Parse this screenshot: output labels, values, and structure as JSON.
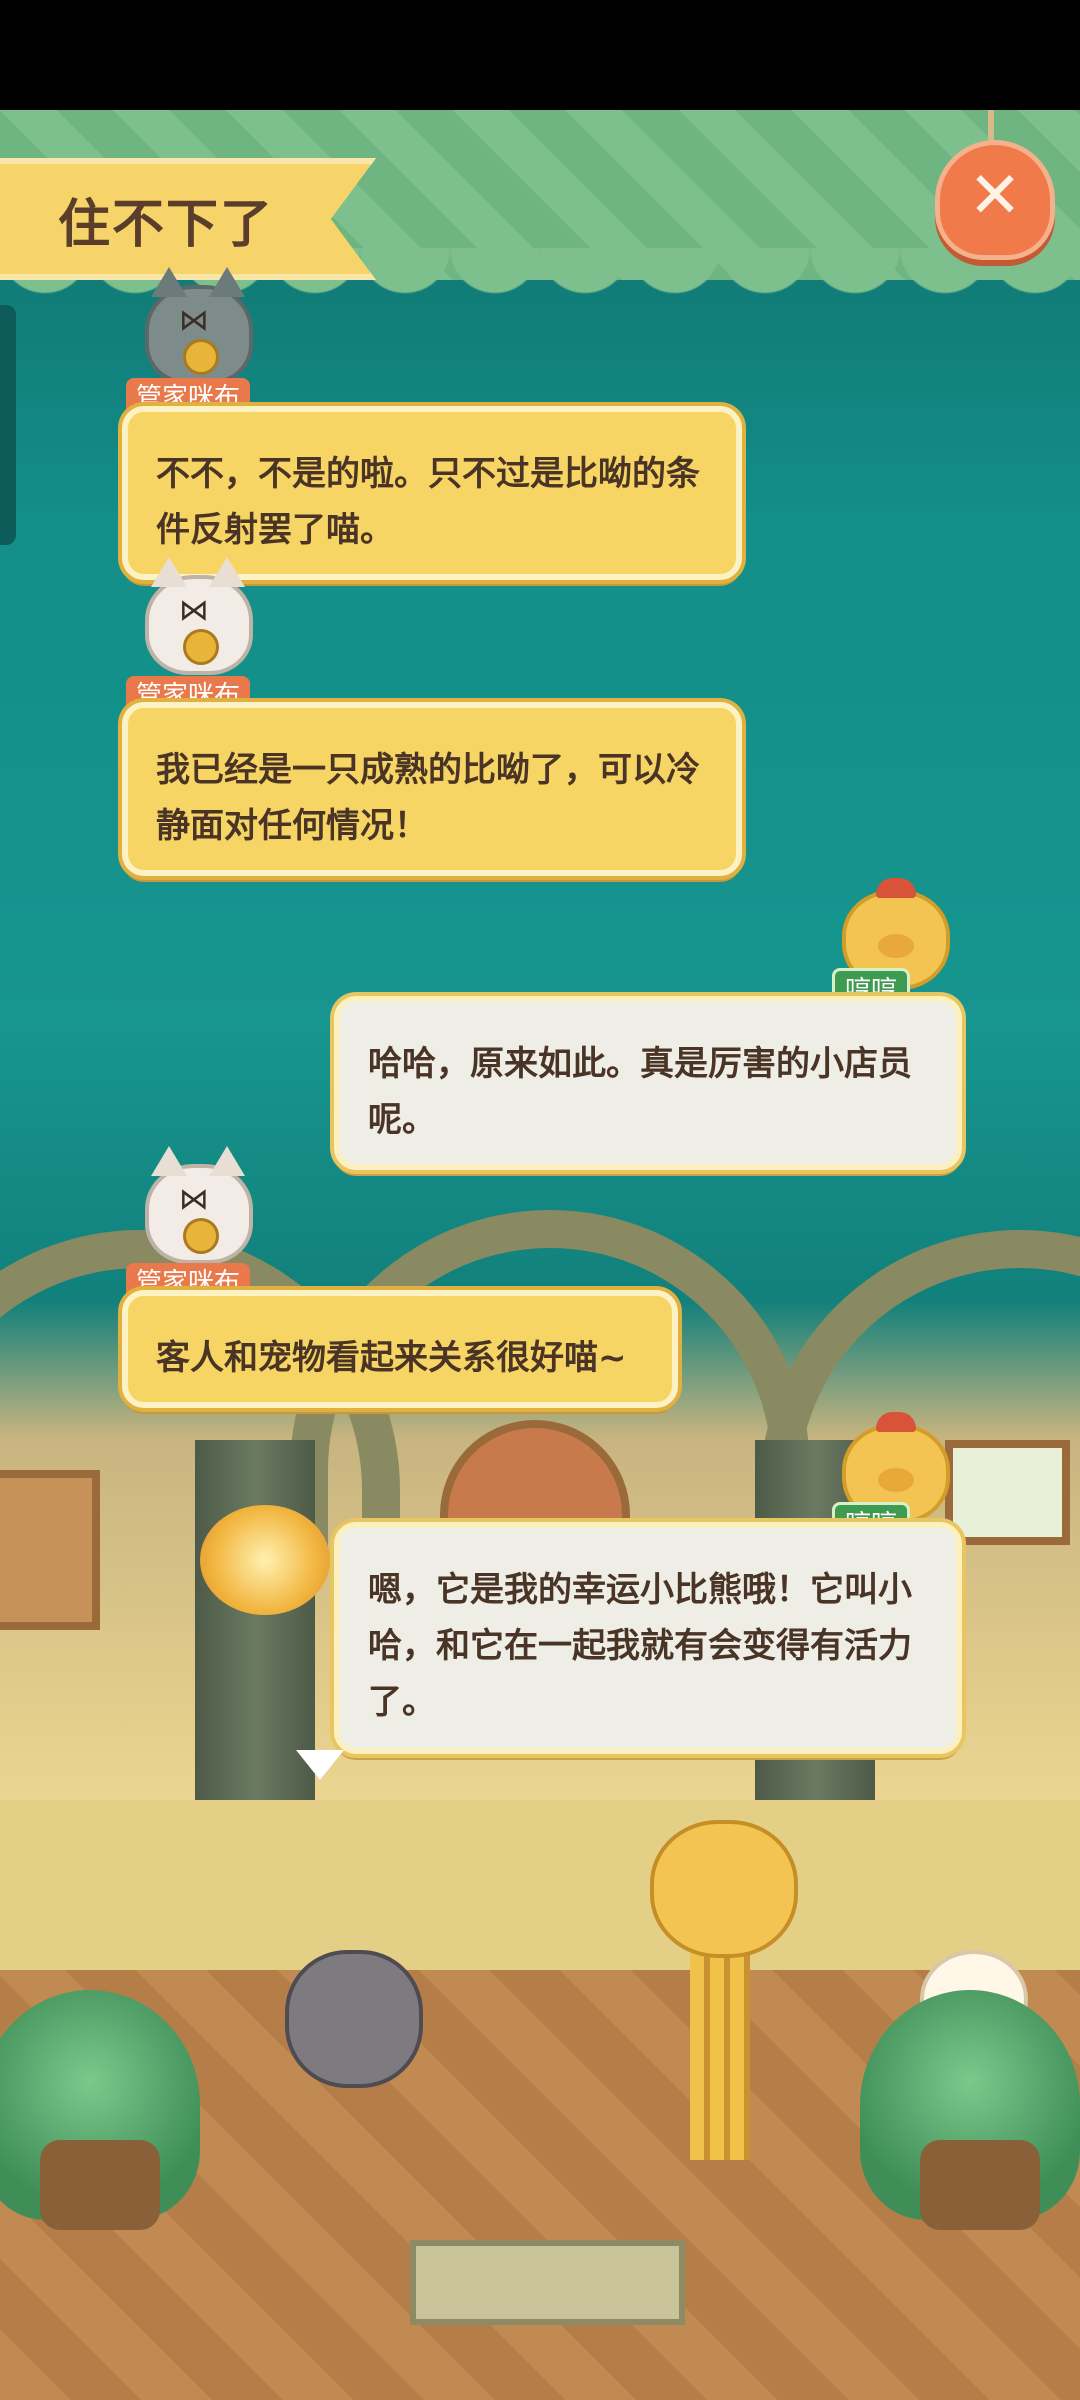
{
  "header": {
    "title": "住不下了",
    "close_icon": "close-x-icon"
  },
  "dialogue": [
    {
      "speaker": "管家咪布",
      "text": "不不，不是的啦。只不过是比呦的条件反射罢了喵。",
      "side": "left",
      "style": "yellow"
    },
    {
      "speaker": "管家咪布",
      "text": "我已经是一只成熟的比呦了，可以冷静面对任何情况！",
      "side": "left",
      "style": "yellow"
    },
    {
      "speaker": "哼哼",
      "text": "哈哈，原来如此。真是厉害的小店员呢。",
      "side": "right",
      "style": "white"
    },
    {
      "speaker": "管家咪布",
      "text": "客人和宠物看起来关系很好喵~",
      "side": "left",
      "style": "yellow"
    },
    {
      "speaker": "哼哼",
      "text": "嗯，它是我的幸运小比熊哦！它叫小哈，和它在一起我就有会变得有活力了。",
      "side": "right",
      "style": "white"
    }
  ],
  "colors": {
    "teal_bg": "#17958f",
    "yellow_bubble": "#f7d564",
    "white_bubble": "#eeeee6",
    "orange_tag": "#e9794a",
    "green_tag": "#3f9a52",
    "close_button": "#f07a4a"
  },
  "icons": {
    "more": "triangle-down-icon",
    "butler_avatar": "cat-butler-icon",
    "guest_avatar": "pig-guest-icon"
  }
}
